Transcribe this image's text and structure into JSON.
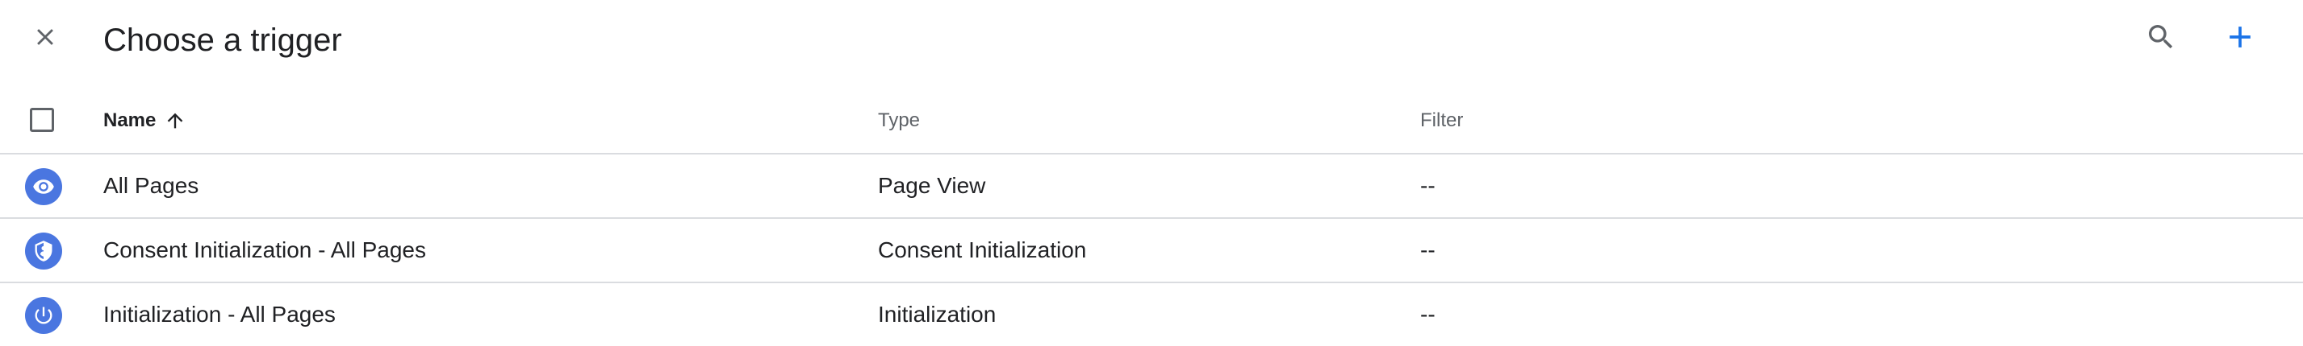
{
  "header": {
    "title": "Choose a trigger",
    "close_icon": "close-icon",
    "search_icon": "search-icon",
    "add_icon": "add-icon"
  },
  "table": {
    "columns": {
      "name": "Name",
      "type": "Type",
      "filter": "Filter"
    },
    "sort": {
      "column": "Name",
      "direction": "ascending",
      "icon": "arrow-up-icon"
    },
    "rows": [
      {
        "icon": "eye-icon",
        "name": "All Pages",
        "type": "Page View",
        "filter": "--"
      },
      {
        "icon": "shield-icon",
        "name": "Consent Initialization - All Pages",
        "type": "Consent Initialization",
        "filter": "--"
      },
      {
        "icon": "power-icon",
        "name": "Initialization - All Pages",
        "type": "Initialization",
        "filter": "--"
      }
    ]
  },
  "colors": {
    "accent": "#1a73e8",
    "trigger_icon_bg": "#4a76e0",
    "divider": "#dadce0",
    "text": "#202124",
    "secondary_text": "#5f6368"
  }
}
